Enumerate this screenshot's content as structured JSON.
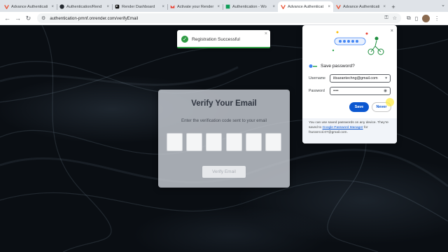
{
  "tabs": [
    {
      "title": "Advance Authenticati",
      "icon": "udemy-icon",
      "active": false
    },
    {
      "title": "Authentication/Rend",
      "icon": "github-icon",
      "active": false
    },
    {
      "title": "Render Dashboard",
      "icon": "render-icon",
      "active": false
    },
    {
      "title": "Activate your Render",
      "icon": "gmail-icon",
      "active": false
    },
    {
      "title": "Authentication - Wo",
      "icon": "udemy-icon",
      "active": false
    },
    {
      "title": "Advance Authenticat",
      "icon": "udemy-icon",
      "active": true
    },
    {
      "title": "Advance Authenticati",
      "icon": "udemy-icon",
      "active": false
    }
  ],
  "browser": {
    "url": "authentication-pmnf.onrender.com/verifyEmail"
  },
  "toast": {
    "message": "Registration Successful",
    "close": "×"
  },
  "verify": {
    "title": "Verify Your Email",
    "subtitle": "Enter the verification code sent to your email",
    "code_boxes": 6,
    "button": "Verify Email"
  },
  "password_popup": {
    "title": "Save password?",
    "username_label": "Username",
    "username_value": "iitsarantechng@gmail.com",
    "password_label": "Password",
    "password_value": "••••",
    "save_button": "Save",
    "never_button": "Never",
    "footer_text_1": "You can use saved passwords on any device. They're saved to",
    "footer_link": "Google Password Manager",
    "footer_text_2": "for",
    "footer_account": "fsuranrcol.07@gmail.com."
  },
  "colors": {
    "accent_blue": "#0b57d0",
    "success_green": "#2e9b43"
  }
}
